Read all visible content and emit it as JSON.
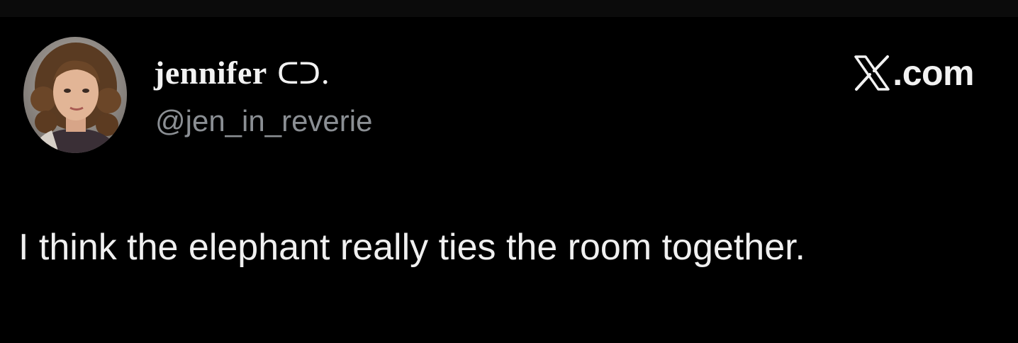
{
  "author": {
    "display_name": "jennifer",
    "display_name_glyph": "ᑕ​ᑐ.",
    "handle": "@jen_in_reverie",
    "avatar_icon": "profile-photo"
  },
  "brand": {
    "icon": "x-logo-icon",
    "text": ".com"
  },
  "tweet": {
    "text": "I think the elephant really ties the room together."
  },
  "colors": {
    "background": "#000000",
    "primary_text": "#f0f0f0",
    "secondary_text": "#8b8f94"
  }
}
